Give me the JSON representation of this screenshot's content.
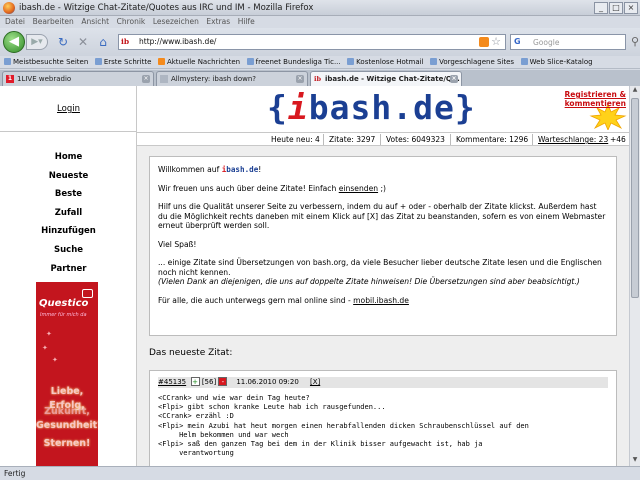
{
  "window": {
    "title": "ibash.de - Witzige Chat-Zitate/Quotes aus IRC und IM - Mozilla Firefox",
    "controls": [
      "_",
      "□",
      "×"
    ]
  },
  "menu": [
    "Datei",
    "Bearbeiten",
    "Ansicht",
    "Chronik",
    "Lesezeichen",
    "Extras",
    "Hilfe"
  ],
  "nav": {
    "url": "http://www.ibash.de/",
    "site_badge": "ib",
    "search_engine": "G",
    "search_placeholder": "Google"
  },
  "bookmarks": [
    "Meistbesuchte Seiten",
    "Erste Schritte",
    "Aktuelle Nachrichten",
    "freenet Bundesliga Tic...",
    "Kostenlose Hotmail",
    "Vorgeschlagene Sites",
    "Web Slice-Katalog"
  ],
  "tabs": [
    {
      "label": "1LIVE webradio",
      "icon": "1"
    },
    {
      "label": "Allmystery: ibash down?",
      "icon": ""
    },
    {
      "label": "ibash.de - Witzige Chat-Zitate/Q...",
      "icon": "ib",
      "active": true
    }
  ],
  "status": "Fertig",
  "site": {
    "login": "Login",
    "logo": {
      "open": "{",
      "i": "i",
      "rest": "bash.de",
      "close": "}"
    },
    "register": [
      "Registrieren &",
      "kommentieren"
    ],
    "nav": [
      "Home",
      "Neueste",
      "Beste",
      "Zufall",
      "Hinzufügen",
      "Suche",
      "Partner"
    ],
    "stats": {
      "today": "Heute neu: 4",
      "quotes": "Zitate: 3297",
      "votes": "Votes: 6049323",
      "comments": "Kommentare: 1296",
      "queue_label": "Warteschlange: 23",
      "queue_extra": "+46"
    },
    "ad": {
      "brand": "Questico",
      "tagline": "Immer für mich da",
      "lines": [
        "Liebe,",
        "Erfolg,",
        "Zukunft,",
        "Gesundheit?",
        "Sternen!"
      ]
    },
    "welcome": {
      "greeting_pre": "Willkommen auf ",
      "brand_i": "i",
      "brand_rest": "bash.de",
      "greeting_post": "!",
      "p2_pre": "Wir freuen uns auch über deine Zitate!  Einfach ",
      "p2_link": "einsenden",
      "p2_post": " ;)",
      "p3": "Hilf uns die Qualität unserer Seite zu verbessern, indem du auf + oder - oberhalb der Zitate klickst. Außerdem hast du die Möglichkeit rechts daneben mit einem Klick auf [X] das Zitat zu beanstanden, sofern es von einem Webmaster erneut überprüft werden soll.",
      "p4": "Viel Spaß!",
      "p5": "... einige Zitate sind Übersetzungen von bash.org, da viele Besucher lieber deutsche Zitate lesen und die Englischen noch nicht kennen.",
      "p5_italic": "(Vielen Dank an diejenigen, die uns auf doppelte Zitate hinweisen! Die Übersetzungen sind aber beabsichtigt.)",
      "p6_pre": "Für alle, die auch unterwegs gern mal online sind - ",
      "p6_link": "mobil.ibash.de"
    },
    "newest_heading": "Das neueste Zitat:",
    "quote": {
      "id": "#45135",
      "plus": "+",
      "score": "[56]",
      "minus": "-",
      "date": "11.06.2010 09:20",
      "report": "[X]",
      "lines": [
        "<CCrank> und wie war dein Tag heute?",
        "<Flpi> gibt schon kranke Leute hab ich rausgefunden...",
        "<CCrank> erzähl :D",
        "<Flpi> mein Azubi hat heut morgen einen herabfallenden dicken Schraubenschlüssel auf den",
        "     Helm bekommen und war wech",
        "<Flpi> saß den ganzen Tag bei dem in der Klinik bisser aufgewacht ist, hab ja",
        "     verantwortung"
      ]
    }
  }
}
